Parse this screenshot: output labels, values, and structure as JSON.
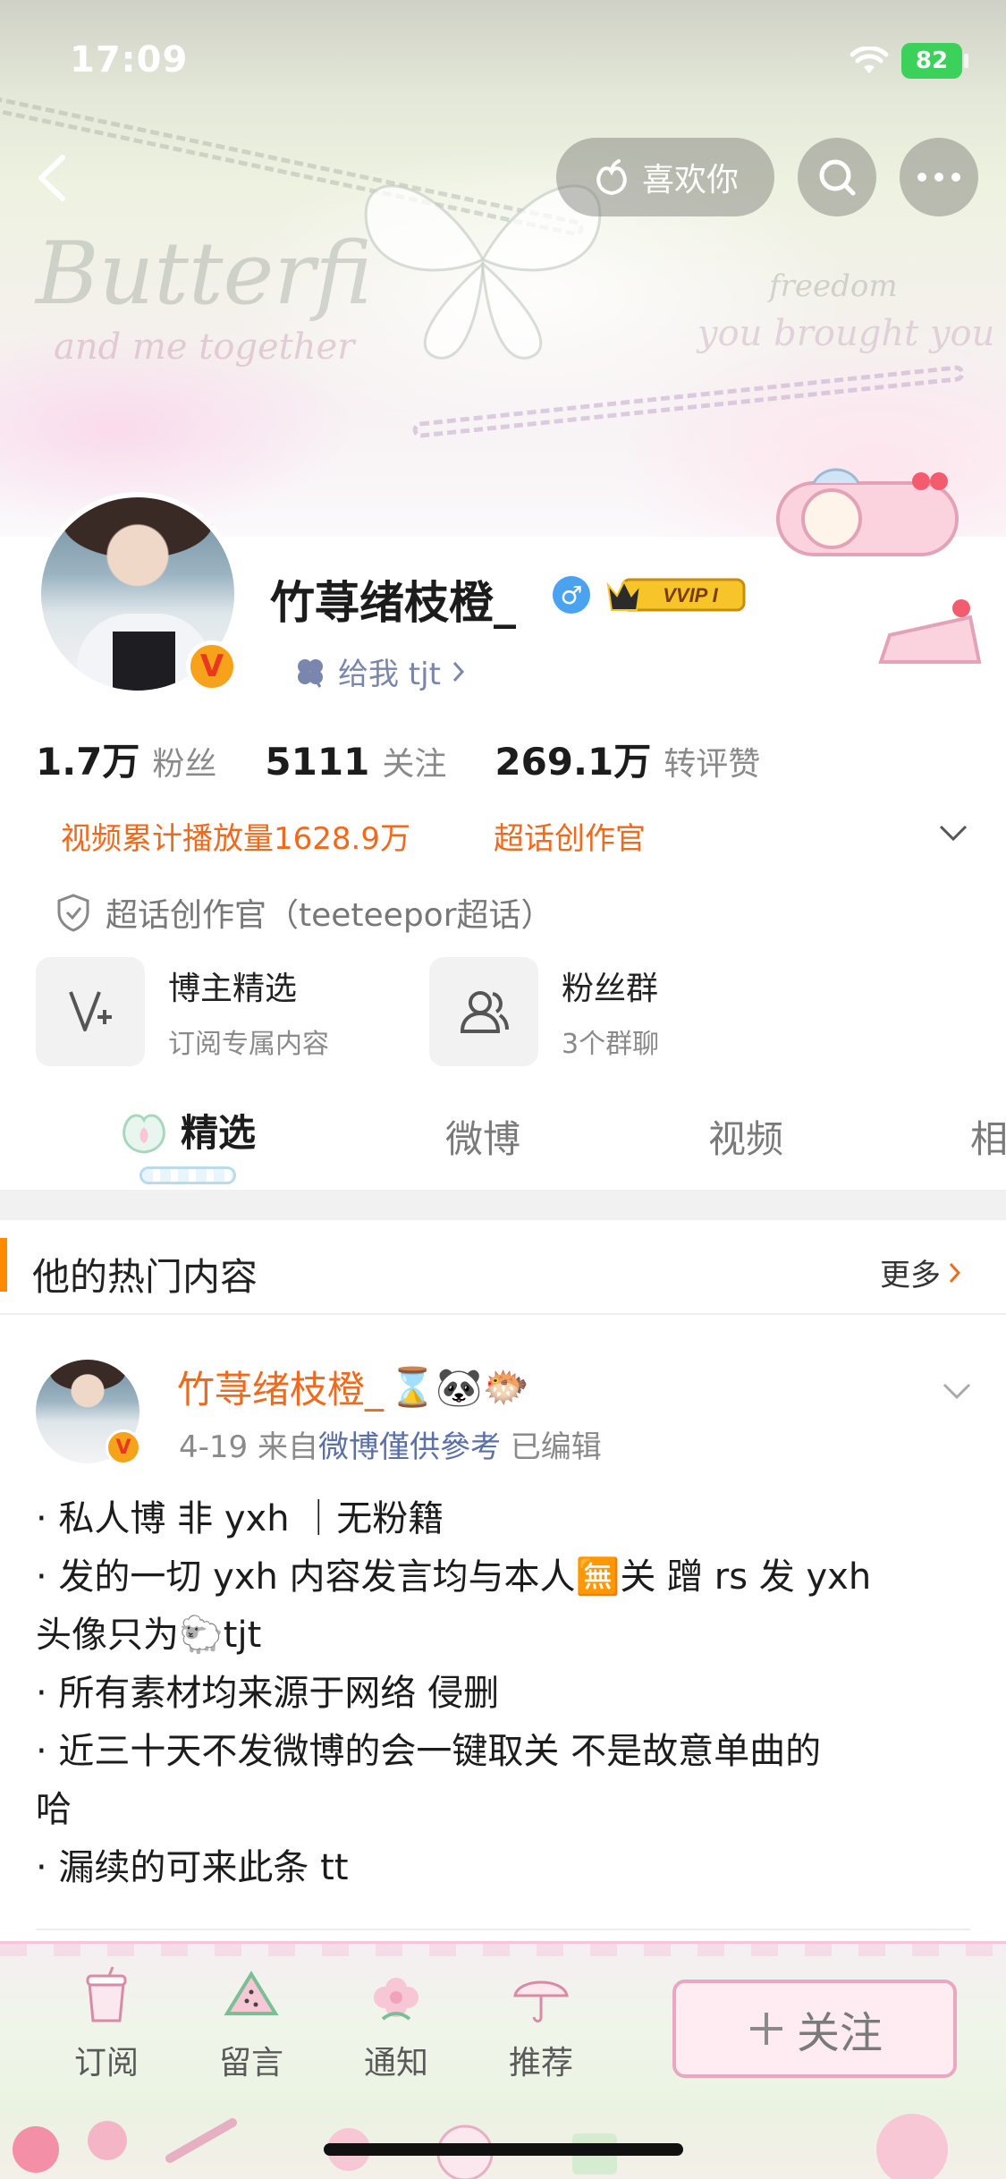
{
  "status_bar": {
    "time": "17:09",
    "battery": "82"
  },
  "top_actions": {
    "like_label": "喜欢你"
  },
  "profile": {
    "username": "竹荨绪枝橙_",
    "vip_label": "VVIP I",
    "verified_badge": "V",
    "gender": "♂",
    "signature": "给我 tjt",
    "stats": [
      {
        "value": "1.7万",
        "label": "粉丝"
      },
      {
        "value": "5111",
        "label": "关注"
      },
      {
        "value": "269.1万",
        "label": "转评赞"
      }
    ],
    "tags": {
      "video_plays": "视频累计播放量1628.9万",
      "creator": "超话创作官"
    },
    "honor": "超话创作官（teeteepor超话）"
  },
  "cards": [
    {
      "title": "博主精选",
      "subtitle": "订阅专属内容"
    },
    {
      "title": "粉丝群",
      "subtitle": "3个群聊"
    }
  ],
  "tabs": [
    {
      "label": "精选",
      "active": true
    },
    {
      "label": "微博",
      "active": false
    },
    {
      "label": "视频",
      "active": false
    },
    {
      "label": "相",
      "active": false
    }
  ],
  "hot_section": {
    "title": "他的热门内容",
    "more_label": "更多"
  },
  "post": {
    "author": "竹荨绪枝橙_",
    "author_emojis": "⌛🐼🐡",
    "date": "4-19",
    "source_prefix": "来自",
    "source": "微博僅供參考",
    "edited": "已编辑",
    "lines": [
      "· 私人博 非 yxh ｜无粉籍",
      "· 发的一切 yxh 内容发言均与本人🈚关  蹭 rs 发 yxh",
      "头像只为🐑tjt",
      "· 所有素材均来源于网络  侵删",
      "· 近三十天不发微博的会一键取关  不是故意单曲的",
      "哈",
      "· 漏续的可来此条 tt"
    ]
  },
  "bottom_nav": [
    {
      "label": "订阅",
      "icon": "cup-icon"
    },
    {
      "label": "留言",
      "icon": "watermelon-icon"
    },
    {
      "label": "通知",
      "icon": "flower-icon"
    },
    {
      "label": "推荐",
      "icon": "umbrella-icon"
    }
  ],
  "follow_button": {
    "label": "关注"
  },
  "colors": {
    "accent_orange": "#f06a1e",
    "link_blue": "#5b6fa8",
    "pink": "#e9a8c2"
  }
}
